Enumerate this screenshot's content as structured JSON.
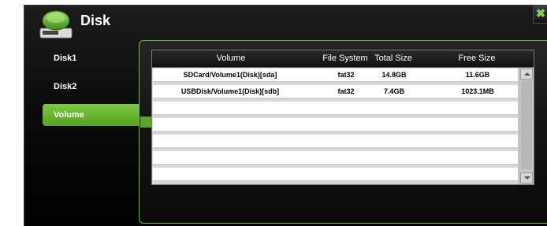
{
  "window": {
    "title": "Disk"
  },
  "close_icon": "✖",
  "sidebar": {
    "items": [
      {
        "label": "Disk1",
        "active": false
      },
      {
        "label": "Disk2",
        "active": false
      },
      {
        "label": "Volume",
        "active": true
      }
    ]
  },
  "table": {
    "headers": [
      "Volume",
      "File System",
      "Total Size",
      "Free Size"
    ],
    "rows": [
      {
        "volume": "SDCard/Volume1(Disk)[sda]",
        "fs": "fat32",
        "total": "14.8GB",
        "free": "11.6GB"
      },
      {
        "volume": "USBDisk/Volume1(Disk)[sdb]",
        "fs": "fat32",
        "total": "7.4GB",
        "free": "1023.1MB"
      }
    ]
  },
  "colors": {
    "accent": "#6fbf3c",
    "active_nav": "#5aa626",
    "window_bg": "#0b0b0b"
  },
  "icons": {
    "logo": "hard-drive-icon",
    "close": "close-icon",
    "scroll_up": "arrow-up-icon",
    "scroll_down": "arrow-down-icon"
  }
}
